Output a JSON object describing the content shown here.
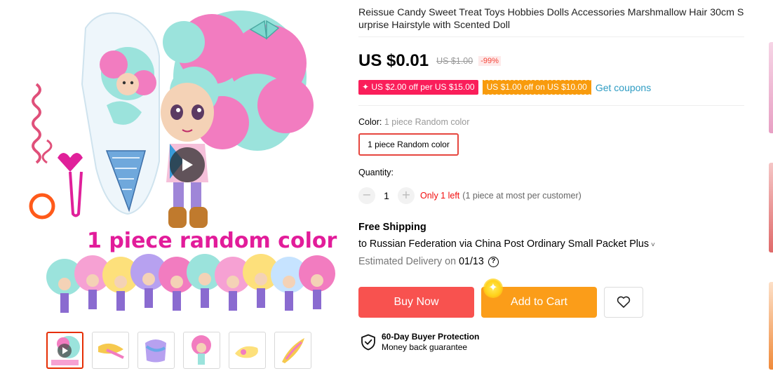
{
  "gallery": {
    "main_image_caption": "1 piece random color",
    "play_icon": "play-icon",
    "thumbnail_count": 6
  },
  "product": {
    "title": "Reissue Candy Sweet Treat Toys Hobbies Dolls Accessories Marshmallow Hair 30cm Surprise Hairstyle with Scented Doll",
    "price": "US $0.01",
    "original_price": "US $1.00",
    "discount": "-99%",
    "coupons": [
      {
        "label": "✦ US $2.00 off per US $15.00"
      },
      {
        "label": "US $1.00 off on US $10.00"
      }
    ],
    "get_coupons": "Get coupons"
  },
  "sku": {
    "label": "Color:",
    "selected": "1 piece Random color",
    "option": "1 piece Random color"
  },
  "quantity": {
    "label": "Quantity:",
    "value": "1",
    "minus": "−",
    "plus": "+",
    "stock_warning": "Only 1 left",
    "limit_note": "(1 piece at most per customer)"
  },
  "shipping": {
    "title": "Free Shipping",
    "destination": "to Russian Federation via China Post Ordinary Small Packet Plus",
    "chevron": "˅",
    "delivery_label": "Estimated Delivery on",
    "delivery_date": "01/13",
    "help": "?"
  },
  "actions": {
    "buy_now": "Buy Now",
    "add_to_cart": "Add to Cart",
    "wishlist_icon": "heart-icon"
  },
  "protection": {
    "title": "60-Day Buyer Protection",
    "subtitle": "Money back guarantee"
  },
  "colors": {
    "price_red": "#f8524f",
    "cart_orange": "#fb9d19",
    "coupon_pink": "#fa1e5a",
    "coupon_orange": "#f89b0d",
    "link_blue": "#2e9cc3",
    "caption_magenta": "#e21c9a"
  }
}
